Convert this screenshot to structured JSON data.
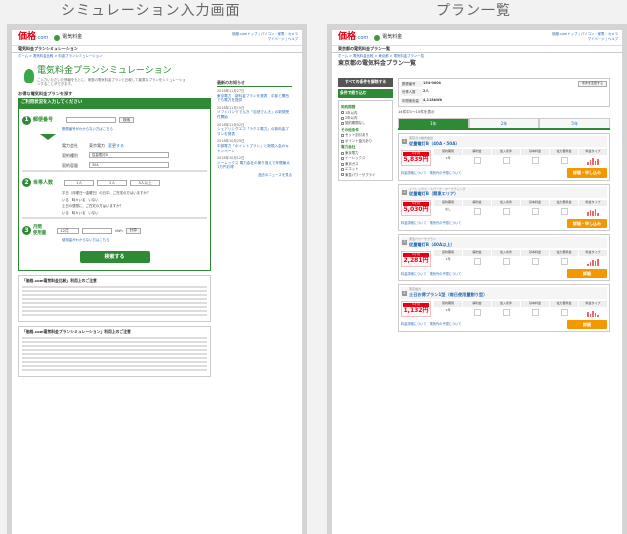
{
  "captions": {
    "left": "シミュレーション入力画面",
    "right": "プラン一覧"
  },
  "header": {
    "logo_main": "価格",
    "logo_com": ".com",
    "service": "電気料金",
    "links": [
      "価格.comトップ",
      "パソコン・家電・カメラ",
      "マイページ",
      "ヘルプ"
    ]
  },
  "left": {
    "subbar": "電気料金プランシミュレーション",
    "breadcrumb": "ホーム > 電気料金比較 > 料金プランシミュレーション",
    "title": "電気料金プランシミュレーション",
    "lead": "ご入力いただいた情報をもとに、家庭の電気料金プランと比較して最適なプランをシミュレーションすることができます。",
    "form_title": "お得な電気料金プランを探す",
    "form_head": "ご利用状況を入力してください",
    "step1": {
      "num": "1",
      "label": "郵便番号",
      "button": "検索",
      "help": "郵便番号がわからない方はこちら"
    },
    "company_label": "電力会社",
    "company_value": "東京電力",
    "company_link": "変更する",
    "plan_label": "契約種別",
    "plan_value": "従量電灯B",
    "amp_label": "契約容量",
    "amp_value": "30A",
    "step2": {
      "num": "2",
      "label": "世帯人数",
      "options": [
        "1人",
        "2人",
        "3人以上"
      ]
    },
    "step2_q1": "平日（月曜日〜金曜日）の日中、ご在宅の方はいますか？",
    "step2_q1_opts": [
      "いる",
      "時々いる",
      "いない"
    ],
    "step2_q2": "土日の昼間に、ご在宅の方はいますか？",
    "step2_q2_opts": [
      "いる",
      "時々いる",
      "いない"
    ],
    "step3": {
      "num": "3",
      "label": "月間\n使用量",
      "month": "12月",
      "unit": "kWh",
      "button": "計算"
    },
    "step3_help": "使用量がわからない方はこちら",
    "search_button": "検索する",
    "notes1_title": "「価格.com電気料金比較」利用上のご注意",
    "notes2_title": "「価格.com電気料金プランシミュレーション」利用上のご注意"
  },
  "news": {
    "title": "最新のお知らせ",
    "items": [
      {
        "date": "2018年11月27日",
        "text": "東京電力　新料金プランを発表　中部と関西でも電力を提供"
      },
      {
        "date": "2018年11月15日",
        "text": "ソフトバンクでんき「自然でんき」の新規受付開始"
      },
      {
        "date": "2018年11月02日",
        "text": "シェアリングエコ「ラクエ電力」の新料金プランを発表"
      },
      {
        "date": "2018年10月25日",
        "text": "中部電力「ポイントプラン」と新規入会のキャンペーン"
      },
      {
        "date": "2018年10月12日",
        "text": "イーレックス 電力会社の乗り換えで年間最大1万円お得"
      }
    ],
    "more": "過去のニュースを見る"
  },
  "right": {
    "subbar": "東京都の電気料金プラン一覧",
    "breadcrumb": "ホーム > 電気料金比較 > 東京都 > 電気料金プラン一覧",
    "title": "東京都の電気料金プラン一覧",
    "side_button": "すべての条件を解除する",
    "filter_title": "条件で絞り込む",
    "filter_sections": [
      {
        "head": "契約期間",
        "items": [
          "1年以内",
          "2年以内",
          "契約期間なし"
        ]
      },
      {
        "head": "その他条件",
        "items": [
          "セット割引あり",
          "ポイント還元あり"
        ]
      },
      {
        "head": "電力会社",
        "items": [
          "東京電力",
          "イーレックス",
          "東京ガス",
          "エネット",
          "東急パワーサプライ"
        ]
      }
    ],
    "cond_rows": [
      {
        "k": "郵便番号",
        "v": "154-0004"
      },
      {
        "k": "世帯人数",
        "v": "2人"
      },
      {
        "k": "年間使用量",
        "v": "4,118kWh"
      }
    ],
    "cond_button": "条件を変更する",
    "result_text": "14件中1〜10件を表示",
    "tabs": [
      "1年",
      "2年",
      "5年"
    ],
    "col_heads": [
      "契約期間",
      "解約金",
      "加入条件",
      "基本料金",
      "電力量料金",
      "料金タイプ"
    ],
    "cards": [
      {
        "rank": "1",
        "company": "東京ガス株式会社",
        "name": "従量電灯B（40A・50A）",
        "price": "5,839円",
        "term": "1年",
        "button": "詳細・申し込み",
        "bars": [
          3,
          5,
          7,
          4,
          6
        ]
      },
      {
        "rank": "2",
        "company": "イーレックス・スパーク・マーケティング",
        "name": "従量電灯B（関東エリア）",
        "price": "5,030円",
        "term": "なし",
        "button": "詳細・申し込み",
        "bars": [
          4,
          6,
          5,
          7,
          3
        ]
      },
      {
        "rank": "3",
        "company": "東急パワーサプライ",
        "name": "従量電灯B（40A以上）",
        "price": "2,281円",
        "term": "1年",
        "button": "詳細",
        "bars": [
          2,
          4,
          6,
          5,
          7
        ]
      },
      {
        "rank": "4",
        "company": "東京電力",
        "name": "土日お得プラン1型（毎日使用量割り型）",
        "price": "1,132円",
        "term": "1年",
        "button": "詳細",
        "bars": [
          5,
          3,
          6,
          4,
          2
        ]
      }
    ],
    "card_links": [
      "料金詳細について",
      "電気代の予想について"
    ]
  }
}
